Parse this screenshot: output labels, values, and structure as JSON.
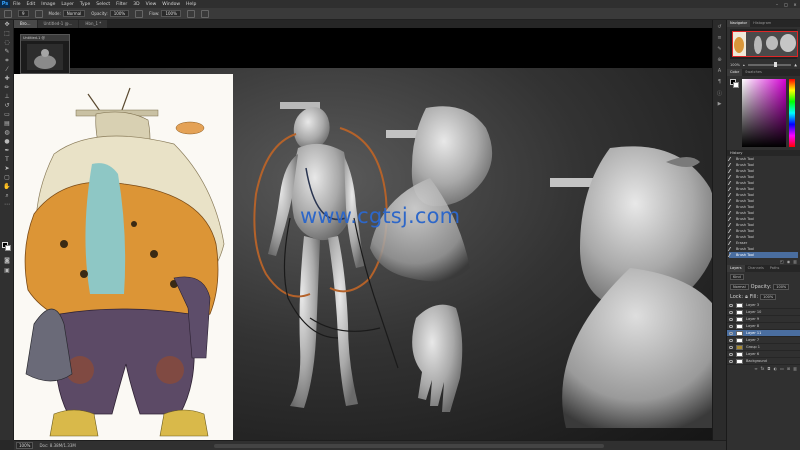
{
  "app": {
    "name": "Ps",
    "menu": [
      "File",
      "Edit",
      "Image",
      "Layer",
      "Type",
      "Select",
      "Filter",
      "3D",
      "View",
      "Window",
      "Help"
    ],
    "doc_title": "Hbn_01",
    "window_controls": [
      "–",
      "□",
      "×"
    ]
  },
  "options": {
    "brush_size": "9",
    "mode_label": "Mode:",
    "mode_value": "Normal",
    "opacity_label": "Opacity:",
    "opacity_value": "100%",
    "flow_label": "Flow:",
    "flow_value": "100%"
  },
  "tabs": [
    {
      "label": "Bro...",
      "active": true
    },
    {
      "label": "Untitled-1 @...",
      "active": false
    },
    {
      "label": "Hbn_1 *",
      "active": false
    }
  ],
  "canvas": {
    "watermark": "www.cgtsj.com",
    "nav_title": "Untitled-1 @"
  },
  "status": {
    "zoom": "100%",
    "doc": "Doc: 8.38M/1.33M"
  },
  "navigator": {
    "tabs": [
      "Navigator",
      "Histogram"
    ],
    "zoom": "100%"
  },
  "color": {
    "tabs": [
      "Color",
      "Swatches"
    ]
  },
  "history": {
    "title": "History",
    "items": [
      {
        "label": "Brush Tool",
        "active": false
      },
      {
        "label": "Brush Tool",
        "active": false
      },
      {
        "label": "Brush Tool",
        "active": false
      },
      {
        "label": "Brush Tool",
        "active": false
      },
      {
        "label": "Brush Tool",
        "active": false
      },
      {
        "label": "Brush Tool",
        "active": false
      },
      {
        "label": "Brush Tool",
        "active": false
      },
      {
        "label": "Brush Tool",
        "active": false
      },
      {
        "label": "Brush Tool",
        "active": false
      },
      {
        "label": "Brush Tool",
        "active": false
      },
      {
        "label": "Brush Tool",
        "active": false
      },
      {
        "label": "Brush Tool",
        "active": false
      },
      {
        "label": "Brush Tool",
        "active": false
      },
      {
        "label": "Brush Tool",
        "active": false
      },
      {
        "label": "Eraser",
        "active": false
      },
      {
        "label": "Brush Tool",
        "active": false
      },
      {
        "label": "Brush Tool",
        "active": true
      }
    ]
  },
  "layers": {
    "tabs": [
      "Layers",
      "Channels",
      "Paths"
    ],
    "kind": "Kind",
    "blend": "Normal",
    "opacity_label": "Opacity:",
    "opacity_value": "100%",
    "lock_label": "Lock:",
    "fill_label": "Fill:",
    "fill_value": "100%",
    "items": [
      {
        "name": "Layer 3",
        "active": false,
        "folder": false
      },
      {
        "name": "Layer 10",
        "active": false,
        "folder": false
      },
      {
        "name": "Layer 9",
        "active": false,
        "folder": false
      },
      {
        "name": "Layer 8",
        "active": false,
        "folder": false
      },
      {
        "name": "Layer 11",
        "active": true,
        "folder": false
      },
      {
        "name": "Layer 7",
        "active": false,
        "folder": false
      },
      {
        "name": "Group 1",
        "active": false,
        "folder": true
      },
      {
        "name": "Layer 6",
        "active": false,
        "folder": false
      },
      {
        "name": "Background",
        "active": false,
        "folder": false
      }
    ]
  }
}
